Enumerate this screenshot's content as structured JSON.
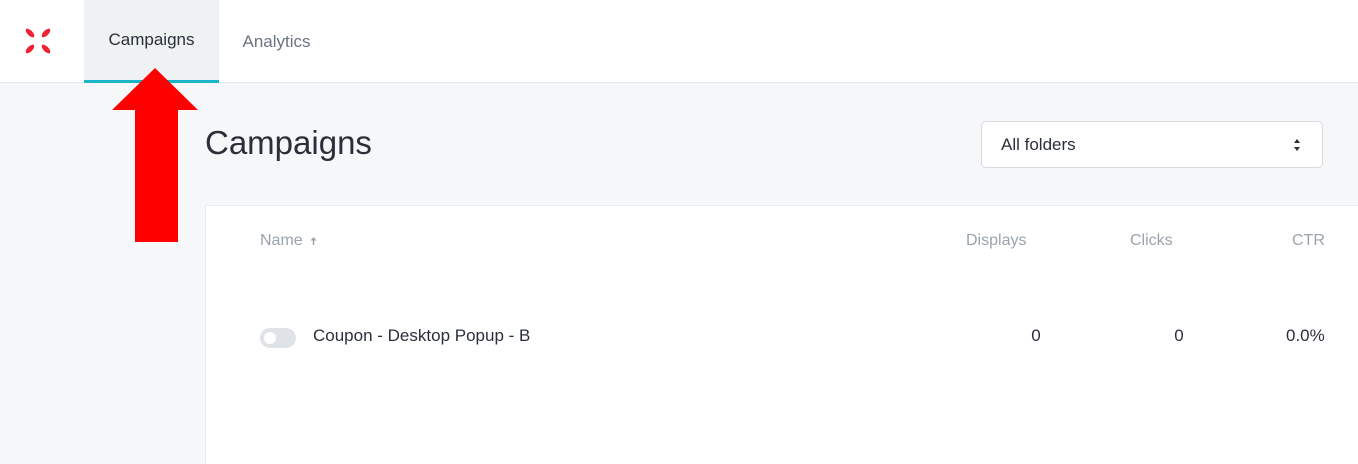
{
  "header": {
    "logo_icon": "x-logo-icon",
    "tabs": [
      {
        "label": "Campaigns",
        "active": true
      },
      {
        "label": "Analytics",
        "active": false
      }
    ]
  },
  "main": {
    "title": "Campaigns",
    "folder_select": {
      "value": "All folders",
      "icon": "up-down-arrows-icon"
    }
  },
  "table": {
    "columns": [
      {
        "label": "Name",
        "sort_icon": "sort-up-arrow-icon"
      },
      {
        "label": "Displays"
      },
      {
        "label": "Clicks"
      },
      {
        "label": "CTR"
      }
    ],
    "rows": [
      {
        "enabled": false,
        "name": "Coupon - Desktop Popup - B",
        "displays": "0",
        "clicks": "0",
        "ctr": "0.0%"
      }
    ]
  },
  "colors": {
    "brand": "#ee2233",
    "active_tab_underline": "#19b6c8",
    "annotation_arrow": "#ff0000"
  }
}
